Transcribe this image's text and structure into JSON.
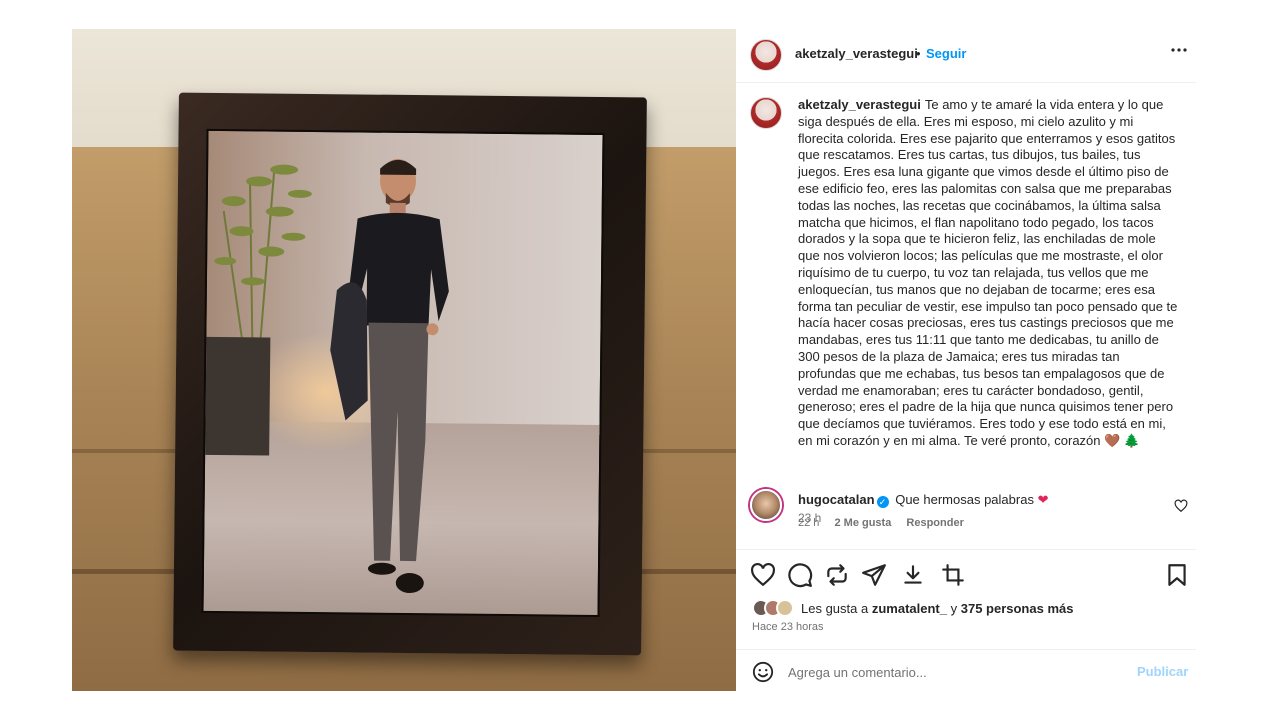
{
  "post": {
    "author": "aketzaly_verastegui",
    "follow_separator": "•",
    "follow_label": "Seguir",
    "more_label": "•••",
    "caption": "Te amo y te amaré la vida entera y lo que siga después de ella. Eres mi esposo, mi cielo azulito y mi florecita colorida. Eres ese pajarito que enterramos y esos gatitos que rescatamos. Eres tus cartas, tus dibujos, tus bailes, tus juegos. Eres esa luna gigante que vimos desde el último piso de ese edificio feo, eres las palomitas con salsa que me preparabas todas las noches, las recetas que cocinábamos, la última salsa matcha que hicimos, el flan napolitano todo pegado, los tacos dorados y la sopa que te hicieron feliz, las enchiladas de mole que nos volvieron locos; las películas que me mostraste, el olor riquísimo de tu cuerpo, tu voz tan relajada, tus vellos que me enloquecían, tus manos que no dejaban de tocarme; eres esa forma tan peculiar de vestir, ese impulso tan poco pensado que te hacía hacer cosas preciosas, eres tus castings preciosos que me mandabas, eres tus 11:11 que tanto me dedicabas, tu anillo de 300 pesos de la plaza de Jamaica; eres tus miradas tan profundas que me echabas, tus besos tan empalagosos que de verdad me enamoraban; eres tu carácter bondadoso, gentil, generoso; eres el padre de la hija que nunca quisimos tener pero que decíamos que tuviéramos. Eres todo y ese todo está en mi, en mi corazón y en mi alma. Te veré pronto, corazón 🤎 🌲",
    "caption_time": "23 h"
  },
  "comment": {
    "user": "hugocatalan",
    "verified_mark": "✓",
    "text": "Que hermosas palabras",
    "emoji": "❤",
    "time": "22 h",
    "likes": "2 Me gusta",
    "reply_label": "Responder"
  },
  "likes": {
    "prefix": "Les gusta a",
    "first_user": "zumatalent_",
    "joiner": "y",
    "others": "375 personas más"
  },
  "post_time": "Hace 23 horas",
  "add_comment": {
    "placeholder": "Agrega un comentario...",
    "publish_label": "Publicar"
  },
  "colors": {
    "accent": "#0095f6",
    "publish_disabled": "#9fd5fc",
    "muted_text": "#737373",
    "heart": "#e0245e"
  },
  "icons": [
    "heart-icon",
    "comment-icon",
    "repost-icon",
    "share-icon",
    "download-icon",
    "crop-icon",
    "bookmark-icon",
    "emoji-icon"
  ]
}
